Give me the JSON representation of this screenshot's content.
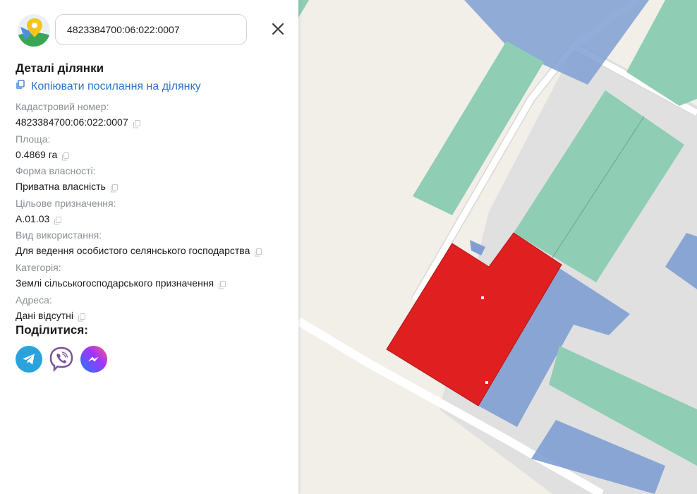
{
  "search": {
    "value": "4823384700:06:022:0007"
  },
  "details": {
    "heading": "Деталі ділянки",
    "copy_link_label": "Копіювати посилання на ділянку",
    "fields": [
      {
        "label": "Кадастровий номер:",
        "value": "4823384700:06:022:0007"
      },
      {
        "label": "Площа:",
        "value": "0.4869 га"
      },
      {
        "label": "Форма власності:",
        "value": "Приватна власність"
      },
      {
        "label": "Цільове призначення:",
        "value": "А.01.03"
      },
      {
        "label": "Вид використання:",
        "value": "Для ведення особистого селянського господарства"
      },
      {
        "label": "Категорія:",
        "value": "Землі сільськогосподарського призначення"
      },
      {
        "label": "Адреса:",
        "value": "Дані відсутні"
      }
    ]
  },
  "share": {
    "heading": "Поділитися:",
    "icons": [
      "telegram-icon",
      "viber-icon",
      "messenger-icon"
    ]
  },
  "colors": {
    "link": "#2f74c9",
    "selected_parcel": "#e02020",
    "parcel_green": "#8fcdb4",
    "parcel_blue": "#7f9fd2",
    "map_background": "#f2efe9",
    "road": "#ffffff"
  }
}
